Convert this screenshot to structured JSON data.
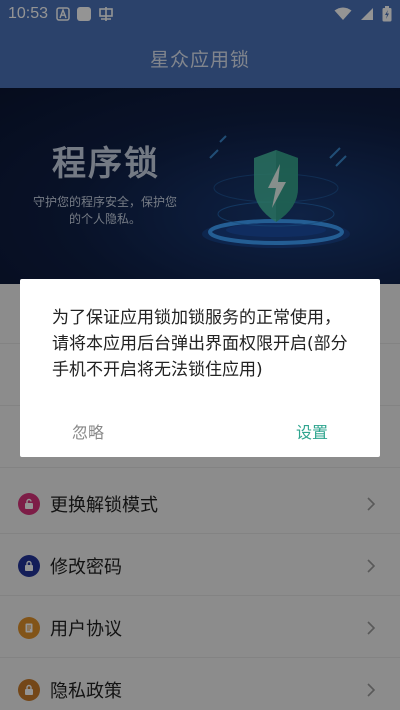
{
  "status_bar": {
    "time": "10:53",
    "left_icons": [
      "font-a-icon",
      "square-icon",
      "carrier-icon"
    ],
    "right_icons": [
      "wifi-icon",
      "signal-icon",
      "battery-charging-icon"
    ]
  },
  "app_bar": {
    "title": "星众应用锁"
  },
  "banner": {
    "title": "程序锁",
    "subtitle": "守护您的程序安全，保护您的个人隐私。",
    "art_icon": "shield-lightning-icon"
  },
  "list": {
    "items": [
      {
        "label": "更换解锁模式",
        "icon": "lock-icon",
        "color": "#d8327a"
      },
      {
        "label": "修改密码",
        "icon": "password-icon",
        "color": "#23349a"
      },
      {
        "label": "用户协议",
        "icon": "document-icon",
        "color": "#e0912a"
      },
      {
        "label": "隐私政策",
        "icon": "privacy-lock-icon",
        "color": "#c87a2a"
      }
    ]
  },
  "dialog": {
    "message": "为了保证应用锁加锁服务的正常使用，请将本应用后台弹出界面权限开启(部分手机不开启将无法锁住应用)",
    "ignore_label": "忽略",
    "settings_label": "设置"
  },
  "colors": {
    "primary": "#4a72b8",
    "accent": "#2fa58f",
    "banner_bg": "#0f1f45"
  }
}
